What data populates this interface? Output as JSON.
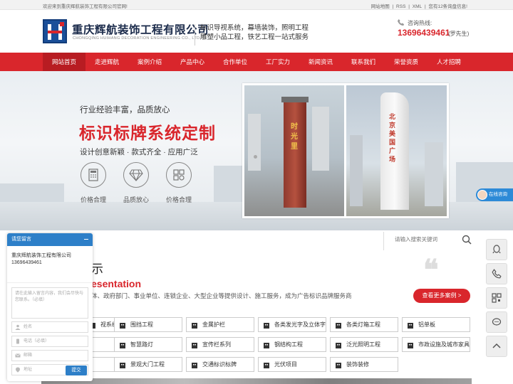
{
  "topbar": {
    "welcome": "欢迎来到重庆辉航装饰工程有限公司官网!",
    "sitemap": "网站地图",
    "rss": "RSS",
    "xml": "XML",
    "sep1": "|",
    "sep2": "|",
    "sep3": "|",
    "messages": "您有12条询盘信息!"
  },
  "header": {
    "company_name": "重庆辉航装饰工程有限公司",
    "company_en": "CHONGQING HUIHANG DECORATION ENGINEERING CO., LTD.",
    "slogan_line1": "标识导视系统，幕墙装饰，照明工程",
    "slogan_line2": "雕塑小品工程，铁艺工程一站式服务",
    "hotline_label": "咨询热线:",
    "hotline_number": "13696439461",
    "hotline_contact": "(罗先生)"
  },
  "nav": {
    "items": [
      "网站首页",
      "走进辉航",
      "案例介绍",
      "产品中心",
      "合作单位",
      "工厂实力",
      "新闻资讯",
      "联系我们",
      "荣誉资质",
      "人才招聘"
    ]
  },
  "banner": {
    "subtitle": "行业经验丰富，品质放心",
    "title": "标识标牌系统定制",
    "tagline": "设计创意新颖 · 款式齐全 · 应用广泛",
    "features": [
      "价格合理",
      "品质放心",
      "价格合理"
    ],
    "sign1_text": "时光里",
    "sign2_text": "北京美国广场"
  },
  "online_service": {
    "label": "在线咨询"
  },
  "search": {
    "placeholder": "请输入搜索关键词"
  },
  "cases": {
    "title": "示",
    "title_en": "esentation",
    "description": "体、政府部门、事业单位、连锁企业、大型企业等提供设计、施工服务，成为广告标识品牌服务商",
    "more_button": "查看更多案例 >",
    "quote_mark": "❝",
    "categories": [
      "视系统",
      "围挡工程",
      "金属护栏",
      "各类发光字及立体字",
      "各类灯箱工程",
      "铝单板",
      "",
      "智慧路灯",
      "宣传栏系列",
      "钢结构工程",
      "泛光照明工程",
      "市政设施及城市家具",
      "",
      "景观大门工程",
      "交通标识标牌",
      "光伏项目",
      "装饰装修"
    ]
  },
  "message_panel": {
    "header": "请您留言",
    "info": "重庆辉航装饰工程有限公司13696439461",
    "textarea_placeholder": "请在此输入留言内容，我们会尽快与您联系。（必填）",
    "name_placeholder": "姓名",
    "phone_placeholder": "电话（必填）",
    "email_placeholder": "邮箱",
    "address_placeholder": "地址",
    "submit": "提交"
  },
  "colors": {
    "brand_red": "#d9262c",
    "brand_blue": "#1a4f99",
    "widget_blue": "#2d7fc8"
  }
}
